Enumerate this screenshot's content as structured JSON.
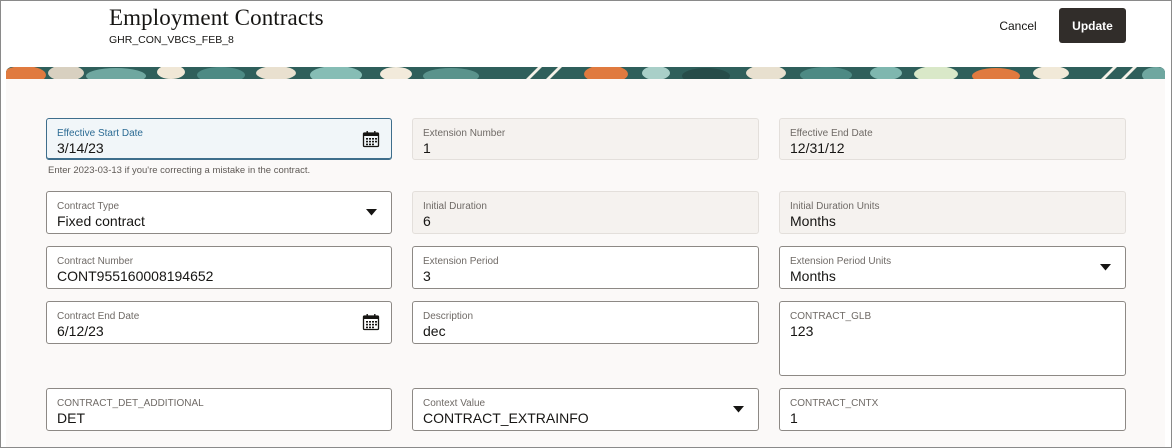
{
  "header": {
    "title": "Employment Contracts",
    "subtitle": "GHR_CON_VBCS_FEB_8",
    "cancel_label": "Cancel",
    "update_label": "Update"
  },
  "colors": {
    "primary_button": "#312d2a",
    "focus_border": "#3e6e8c",
    "panel_bg": "#fbf9f8"
  },
  "form": {
    "effective_start_date": {
      "label": "Effective Start Date",
      "value": "3/14/23",
      "helper": "Enter 2023-03-13 if you're correcting a mistake in the contract."
    },
    "extension_number": {
      "label": "Extension Number",
      "value": "1"
    },
    "effective_end_date": {
      "label": "Effective End Date",
      "value": "12/31/12"
    },
    "contract_type": {
      "label": "Contract Type",
      "value": "Fixed contract"
    },
    "initial_duration": {
      "label": "Initial Duration",
      "value": "6"
    },
    "initial_duration_units": {
      "label": "Initial Duration Units",
      "value": "Months"
    },
    "contract_number": {
      "label": "Contract Number",
      "value": "CONT955160008194652"
    },
    "extension_period": {
      "label": "Extension Period",
      "value": "3"
    },
    "extension_period_units": {
      "label": "Extension Period Units",
      "value": "Months"
    },
    "contract_end_date": {
      "label": "Contract End Date",
      "value": "6/12/23"
    },
    "description": {
      "label": "Description",
      "value": "dec"
    },
    "contract_glb": {
      "label": "CONTRACT_GLB",
      "value": "123"
    },
    "contract_det_additional": {
      "label": "CONTRACT_DET_ADDITIONAL",
      "value": "DET"
    },
    "context_value": {
      "label": "Context Value",
      "value": "CONTRACT_EXTRAINFO"
    },
    "contract_cntx": {
      "label": "CONTRACT_CNTX",
      "value": "1"
    }
  }
}
